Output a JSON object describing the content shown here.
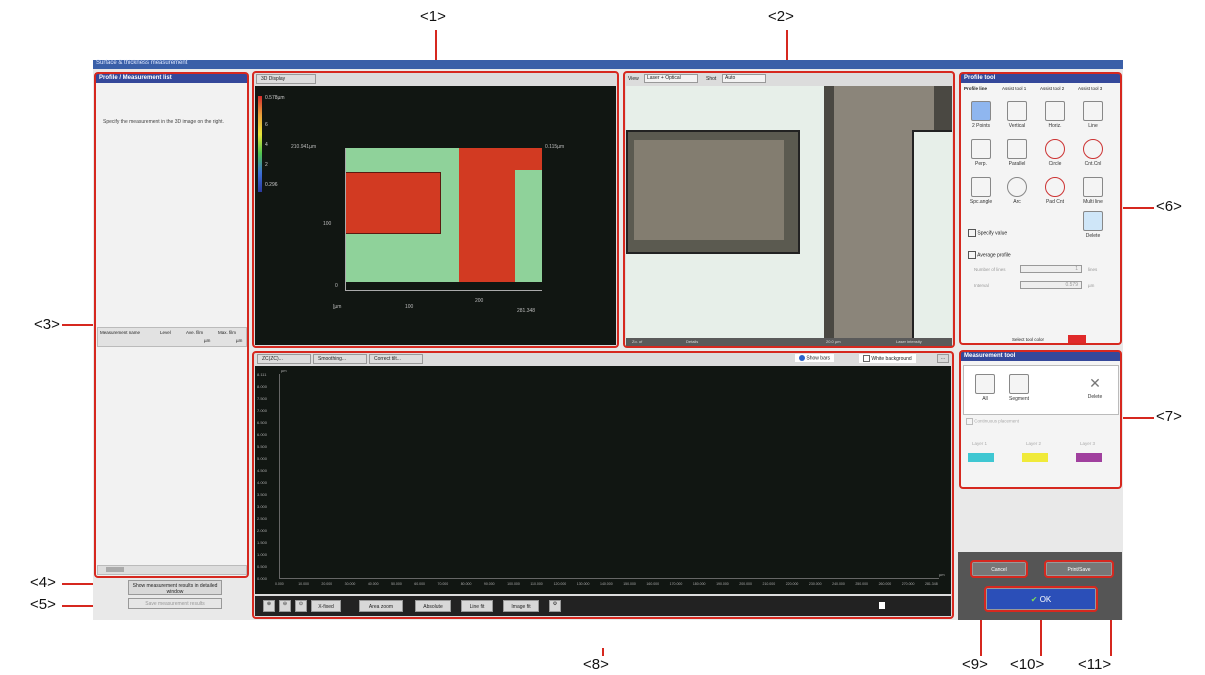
{
  "window": {
    "title": "Surface & thickness measurement"
  },
  "callouts": [
    "<1>",
    "<2>",
    "<3>",
    "<4>",
    "<5>",
    "<6>",
    "<7>",
    "<8>",
    "<9>",
    "<10>",
    "<11>"
  ],
  "left_panel": {
    "header": "Profile / Measurement list",
    "hint": "Specify the measurement in the 3D image on the right.",
    "table_headers": [
      "Measurement name",
      "Level",
      "Ave. film",
      "Max. film"
    ],
    "units": [
      "µm",
      "µm"
    ],
    "show_results_button": "Show measurement results in detailed window",
    "save_button": "Save measurement results"
  },
  "display3d": {
    "tab": "3D Display",
    "scale_max": "0.578µm",
    "scale_ticks": [
      "0.578µm",
      "6",
      "4",
      "2",
      "0.296"
    ],
    "y_labels": [
      "210.941µm",
      "100",
      "0",
      "[µm"
    ],
    "x_labels": [
      "100",
      "200",
      "281.348"
    ],
    "z_label": "0.115µm"
  },
  "optical": {
    "view_label": "View",
    "view_value": "Laser + Optical",
    "shot_label": "Shot",
    "shot_value": "Auto",
    "bottom_bar": [
      "Zo. of",
      "Details",
      "20.0 µm",
      "Laser intensity"
    ]
  },
  "profile_tool": {
    "header": "Profile tool",
    "tabs": [
      "Profile line",
      "Assist tool 1",
      "Assist tool 2",
      "Assist tool 3"
    ],
    "tools": [
      "2 Points",
      "Vertical",
      "Horiz.",
      "Line",
      "Perp.",
      "Parallel",
      "Circle",
      "Cnt.Cnl",
      "Spc.angle",
      "Arc",
      "Pad Cnt",
      "Multi line",
      "Delete"
    ],
    "specify_value": "Specify value",
    "average_profile": "Average profile",
    "number_of_lines_label": "Number of lines",
    "number_of_lines_value": "1",
    "number_of_lines_unit": "lines",
    "interval_label": "Interval",
    "interval_value": "0.579",
    "interval_unit": "µm",
    "select_color_label": "Select tool color",
    "select_color": "#e02a2a"
  },
  "measurement_tool": {
    "header": "Measurement tool",
    "buttons": [
      "All",
      "Segment",
      "Delete"
    ],
    "continuous": "Continuous placement",
    "layers": [
      {
        "label": "Layer 1",
        "color": "#3fc7d2"
      },
      {
        "label": "Layer 2",
        "color": "#f0ea3a"
      },
      {
        "label": "Layer 3",
        "color": "#a0409e"
      }
    ]
  },
  "profile_graph": {
    "tabs": [
      "ZC(ZC)...",
      "Smoothing...",
      "Correct tilt..."
    ],
    "options": [
      "Show bars",
      "White background"
    ],
    "y_unit": "µm",
    "y_ticks": [
      "8.111",
      "8.000",
      "7.500",
      "7.000",
      "6.500",
      "6.000",
      "5.500",
      "5.000",
      "4.500",
      "4.000",
      "3.500",
      "3.000",
      "2.500",
      "2.000",
      "1.500",
      "1.000",
      "0.500",
      "0.000"
    ],
    "x_ticks": [
      "0.000",
      "10.000",
      "20.000",
      "30.000",
      "40.000",
      "50.000",
      "60.000",
      "70.000",
      "80.000",
      "90.000",
      "100.000",
      "110.000",
      "120.000",
      "130.000",
      "140.000",
      "150.000",
      "160.000",
      "170.000",
      "180.000",
      "190.000",
      "200.000",
      "210.000",
      "220.000",
      "230.000",
      "240.000",
      "250.000",
      "260.000",
      "270.000",
      "281.348"
    ],
    "x_unit": "µm",
    "toolbar": [
      "X-fixed",
      "Area zoom",
      "Absolute",
      "Line fit",
      "Image fit"
    ]
  },
  "actions": {
    "cancel": "Cancel",
    "print_save": "Print/Save",
    "ok": "OK"
  },
  "colors": {
    "highlight": "#d6281f",
    "panel_header": "#34489a",
    "plot_bg": "#111612",
    "green": "#8fd29a",
    "red": "#d23a22"
  }
}
